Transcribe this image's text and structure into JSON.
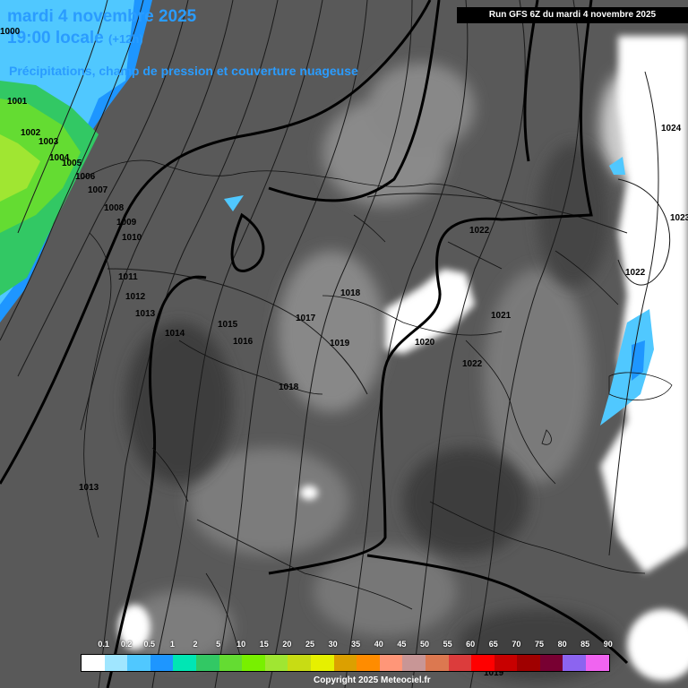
{
  "header": {
    "date": "mardi 4 novembre 2025",
    "time": "19:00 locale",
    "offset": "(+12h)",
    "subtitle": "Précipitations, champ de pression et couverture nuageuse",
    "run": "Run GFS 6Z du mardi 4 novembre 2025"
  },
  "isobars": [
    "1000",
    "1001",
    "1002",
    "1003",
    "1004",
    "1005",
    "1006",
    "1007",
    "1008",
    "1009",
    "1010",
    "1011",
    "1012",
    "1013",
    "1014",
    "1015",
    "1016",
    "1017",
    "1018",
    "1019",
    "1020",
    "1021",
    "1022",
    "1022",
    "1022",
    "1023",
    "1024",
    "1018",
    "1013",
    "1019"
  ],
  "legend": {
    "labels": [
      "0.1",
      "0.2",
      "0.5",
      "1",
      "2",
      "5",
      "10",
      "15",
      "20",
      "25",
      "30",
      "35",
      "40",
      "45",
      "50",
      "55",
      "60",
      "65",
      "70",
      "75",
      "80",
      "85",
      "90"
    ],
    "colors": [
      "#ffffff",
      "#a0e6ff",
      "#50c8ff",
      "#1e96ff",
      "#00e6b4",
      "#32c864",
      "#64dc32",
      "#78f000",
      "#a0e632",
      "#c8dc14",
      "#e6f000",
      "#dca000",
      "#ff8c00",
      "#ff9678",
      "#c89696",
      "#dc7850",
      "#dc3c3c",
      "#ff0000",
      "#c80000",
      "#a00000",
      "#780032",
      "#8c64f0",
      "#f064f0"
    ]
  },
  "copyright": "Copyright 2025 Meteociel.fr"
}
